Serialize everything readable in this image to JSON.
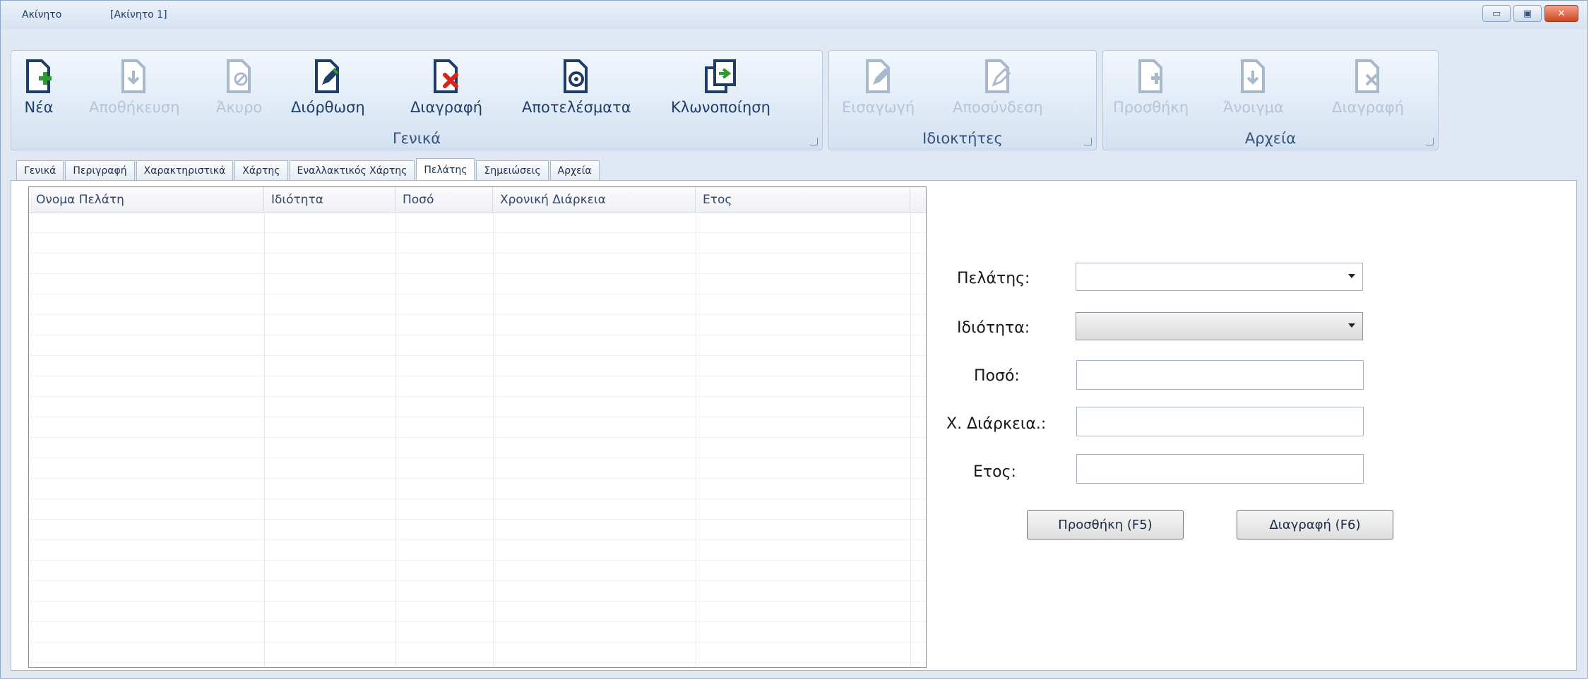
{
  "window": {
    "app_title": "Ακίνητο",
    "doc_title": "[Ακίνητο 1]",
    "minimize_glyph": "▭",
    "maximize_glyph": "▣",
    "close_glyph": "✕"
  },
  "ribbon": {
    "general": {
      "label": "Γενικά",
      "buttons": [
        {
          "label": "Νέα",
          "icon": "new-document-icon",
          "enabled": true
        },
        {
          "label": "Αποθήκευση",
          "icon": "save-document-icon",
          "enabled": false
        },
        {
          "label": "Άκυρο",
          "icon": "cancel-document-icon",
          "enabled": false
        },
        {
          "label": "Διόρθωση",
          "icon": "edit-document-icon",
          "enabled": true
        },
        {
          "label": "Διαγραφή",
          "icon": "delete-document-icon",
          "enabled": true
        },
        {
          "label": "Αποτελέσματα",
          "icon": "results-document-icon",
          "enabled": true
        },
        {
          "label": "Κλωνοποίηση",
          "icon": "clone-document-icon",
          "enabled": true
        }
      ]
    },
    "owners": {
      "label": "Ιδιοκτήτες",
      "buttons": [
        {
          "label": "Εισαγωγή",
          "icon": "owner-add-icon",
          "enabled": false
        },
        {
          "label": "Αποσύνδεση",
          "icon": "owner-remove-icon",
          "enabled": false
        }
      ]
    },
    "files": {
      "label": "Αρχεία",
      "buttons": [
        {
          "label": "Προσθήκη",
          "icon": "file-add-icon",
          "enabled": false
        },
        {
          "label": "Άνοιγμα",
          "icon": "file-open-icon",
          "enabled": false
        },
        {
          "label": "Διαγραφή",
          "icon": "file-delete-icon",
          "enabled": false
        }
      ]
    }
  },
  "tabs": [
    {
      "label": "Γενικά",
      "active": false
    },
    {
      "label": "Περιγραφή",
      "active": false
    },
    {
      "label": "Χαρακτηριστικά",
      "active": false
    },
    {
      "label": "Χάρτης",
      "active": false
    },
    {
      "label": "Εναλλακτικός Χάρτης",
      "active": false
    },
    {
      "label": "Πελάτης",
      "active": true
    },
    {
      "label": "Σημειώσεις",
      "active": false
    },
    {
      "label": "Αρχεία",
      "active": false
    }
  ],
  "grid": {
    "columns": [
      "Ονομα Πελάτη",
      "Ιδιότητα",
      "Ποσό",
      "Χρονική Διάρκεια",
      "Ετος"
    ],
    "rows": []
  },
  "form": {
    "customer_label": "Πελάτης:",
    "customer_value": "",
    "property_label": "Ιδιότητα:",
    "property_value": "",
    "amount_label": "Ποσό:",
    "amount_value": "",
    "duration_label": "Χ. Διάρκεια.:",
    "duration_value": "",
    "year_label": "Ετος:",
    "year_value": "",
    "add_button": "Προσθήκη (F5)",
    "delete_button": "Διαγραφή (F6)"
  },
  "colors": {
    "accent_green": "#2f9a2f",
    "accent_red": "#d8241a",
    "icon_dark": "#1e3d68"
  }
}
